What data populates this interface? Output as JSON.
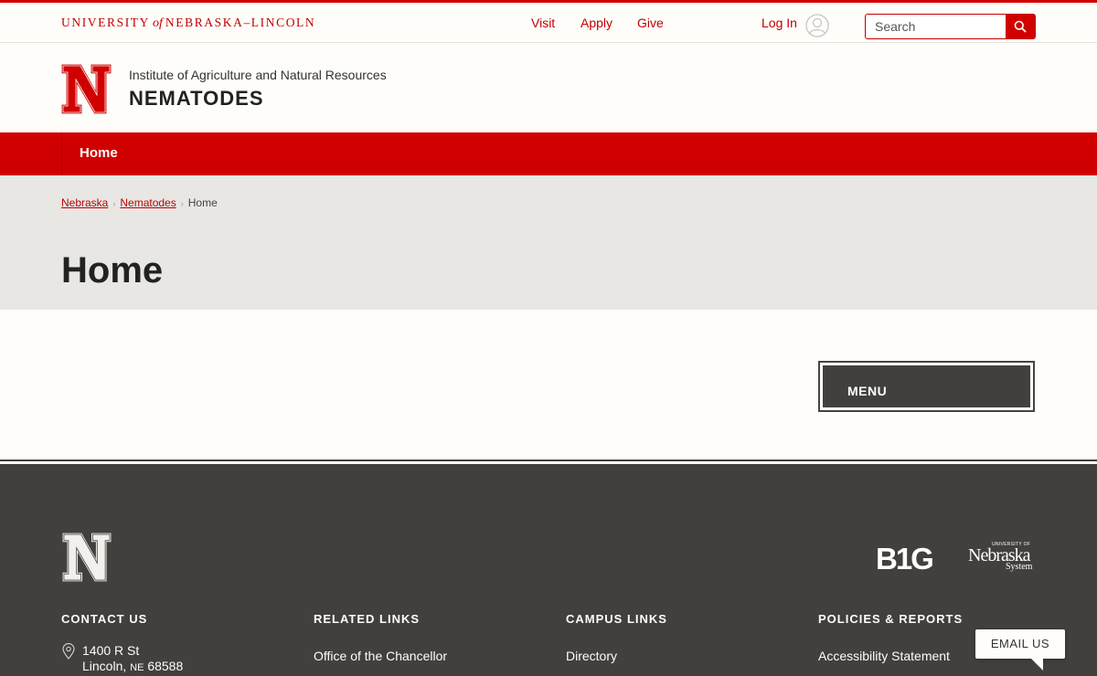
{
  "topbar": {
    "wordmark_pre": "UNIVERSITY",
    "wordmark_of": "of",
    "wordmark_post": "NEBRASKA–LINCOLN",
    "links": [
      "Visit",
      "Apply",
      "Give"
    ],
    "login_label": "Log In",
    "search_placeholder": "Search",
    "accent_color": "#d00000"
  },
  "header": {
    "institute": "Institute of Agriculture and Natural Resources",
    "site_title": "NEMATODES"
  },
  "navbar": {
    "items": [
      "Home"
    ]
  },
  "hero": {
    "breadcrumbs": [
      "Nebraska",
      "Nematodes",
      "Home"
    ],
    "page_title": "Home"
  },
  "main": {
    "menu_label": "MENU"
  },
  "footer": {
    "big_logo_text": "B1G",
    "nu_system_small": "UNIVERSITY OF",
    "nu_system_main": "Nebraska",
    "nu_system_sub": "System",
    "columns": [
      {
        "heading": "CONTACT US",
        "address_line1": "1400 R St",
        "address_city": "Lincoln,",
        "address_state": "NE",
        "address_zip": "68588"
      },
      {
        "heading": "RELATED LINKS",
        "link": "Office of the Chancellor"
      },
      {
        "heading": "CAMPUS LINKS",
        "link": "Directory"
      },
      {
        "heading": "POLICIES & REPORTS",
        "link": "Accessibility Statement"
      }
    ],
    "background_color": "#41403d"
  },
  "email_us": "EMAIL US"
}
